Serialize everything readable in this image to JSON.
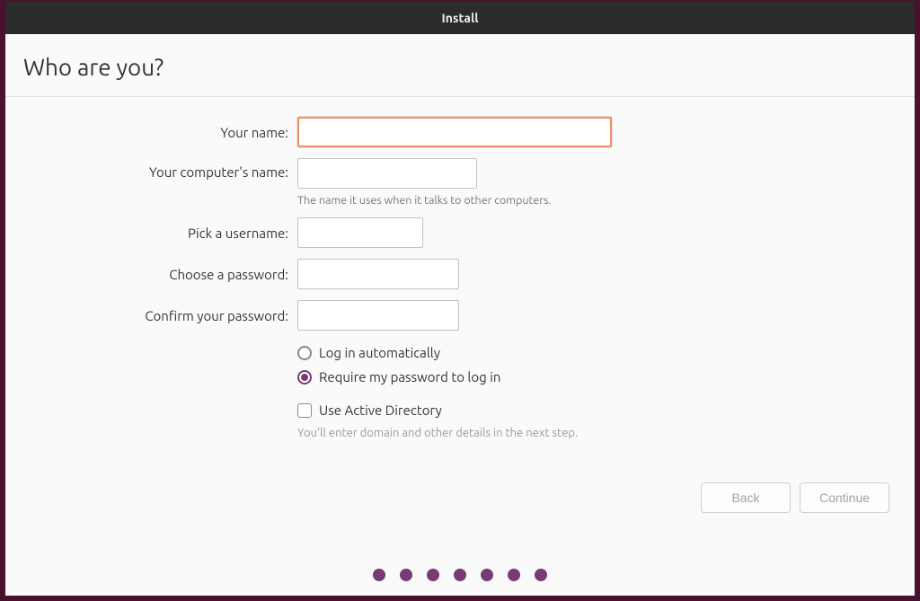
{
  "window": {
    "title": "Install"
  },
  "heading": "Who are you?",
  "fields": {
    "your_name": {
      "label": "Your name:",
      "value": ""
    },
    "computer_name": {
      "label": "Your computer's name:",
      "value": "",
      "hint": "The name it uses when it talks to other computers."
    },
    "username": {
      "label": "Pick a username:",
      "value": ""
    },
    "password": {
      "label": "Choose a password:",
      "value": ""
    },
    "confirm_password": {
      "label": "Confirm your password:",
      "value": ""
    }
  },
  "login_options": {
    "auto": {
      "label": "Log in automatically",
      "selected": false
    },
    "require_password": {
      "label": "Require my password to log in",
      "selected": true
    }
  },
  "active_directory": {
    "label": "Use Active Directory",
    "checked": false,
    "hint": "You'll enter domain and other details in the next step."
  },
  "buttons": {
    "back": "Back",
    "continue": "Continue"
  },
  "progress": {
    "total_dots": 7
  },
  "colors": {
    "accent": "#763b74",
    "focus_border": "#e99169",
    "titlebar_bg": "#2c2c2c",
    "desktop_bg": "#4a1030"
  }
}
